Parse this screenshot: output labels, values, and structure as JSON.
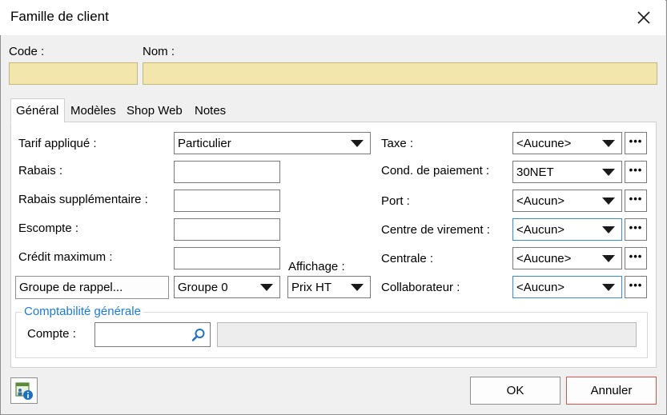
{
  "window": {
    "title": "Famille de client"
  },
  "header": {
    "code_label": "Code :",
    "code_value": "",
    "nom_label": "Nom :",
    "nom_value": ""
  },
  "tabs": [
    {
      "label": "Général",
      "active": true
    },
    {
      "label": "Modèles",
      "active": false
    },
    {
      "label": "Shop Web",
      "active": false
    },
    {
      "label": "Notes",
      "active": false
    }
  ],
  "left": {
    "tarif_label": "Tarif appliqué :",
    "tarif_value": "Particulier",
    "rabais_label": "Rabais :",
    "rabais_value": "",
    "rabais_sup_label": "Rabais supplémentaire :",
    "rabais_sup_value": "",
    "escompte_label": "Escompte :",
    "escompte_value": "",
    "credit_label": "Crédit maximum :",
    "credit_value": "",
    "groupe_rappel_button": "Groupe de rappel...",
    "groupe_rappel_value": "Groupe 0",
    "affichage_label": "Affichage :",
    "affichage_value": "Prix HT"
  },
  "right": {
    "taxe_label": "Taxe :",
    "taxe_value": "<Aucune>",
    "cond_label": "Cond. de paiement :",
    "cond_value": "30NET",
    "port_label": "Port :",
    "port_value": "<Aucun>",
    "centre_label": "Centre de virement :",
    "centre_value": "<Aucun>",
    "centrale_label": "Centrale :",
    "centrale_value": "<Aucune>",
    "collab_label": "Collaborateur :",
    "collab_value": "<Aucun>",
    "dots": "•••"
  },
  "compta": {
    "title": "Comptabilité générale",
    "compte_label": "Compte :",
    "compte_value": "",
    "compte_desc": ""
  },
  "footer": {
    "ok_label": "OK",
    "cancel_label": "Annuler"
  },
  "colors": {
    "required_field": "#f3e6ad",
    "accent": "#1e7bd3",
    "cancel_border": "#d9534f"
  }
}
